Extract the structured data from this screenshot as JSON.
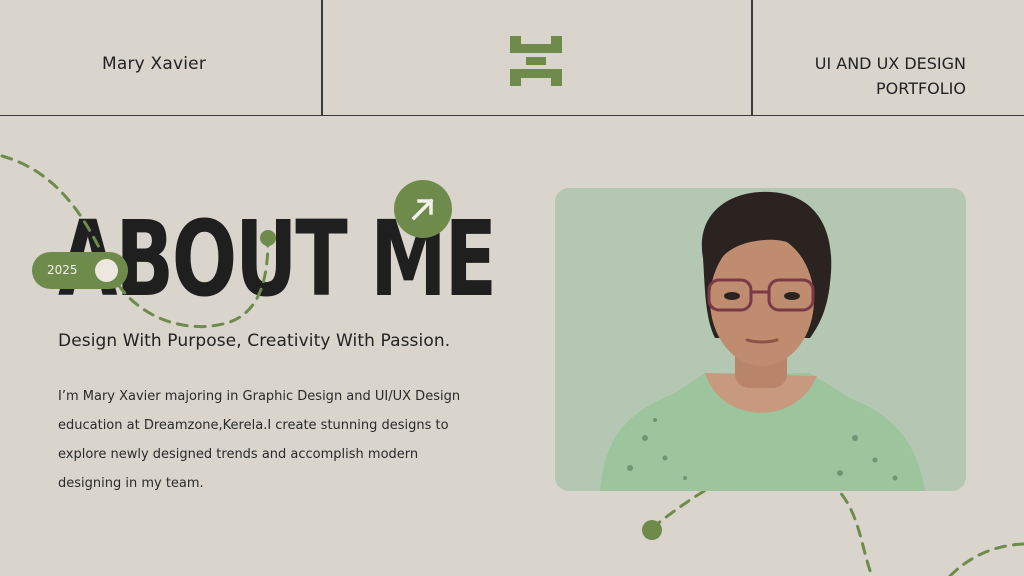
{
  "header": {
    "name": "Mary Xavier",
    "title_line1": "UI AND UX DESIGN",
    "title_line2": "PORTFOLIO",
    "logo_icon": "h-monogram-logo"
  },
  "hero": {
    "heading": "ABOUT ME",
    "year": "2025",
    "tagline": "Design With Purpose, Creativity With Passion.",
    "bio_lines": [
      "I’m Mary Xavier majoring in Graphic Design and UI/UX Design",
      "education at Dreamzone,Kerela.I create stunning designs to",
      "explore newly designed trends and accomplish modern",
      "designing in my team."
    ]
  },
  "photo": {
    "icon": "portrait-photo"
  },
  "colors": {
    "background": "#d9d5cd",
    "accent": "#6f8b4c",
    "photo_bg": "#b4c7b2",
    "text": "#1e1e1e"
  }
}
